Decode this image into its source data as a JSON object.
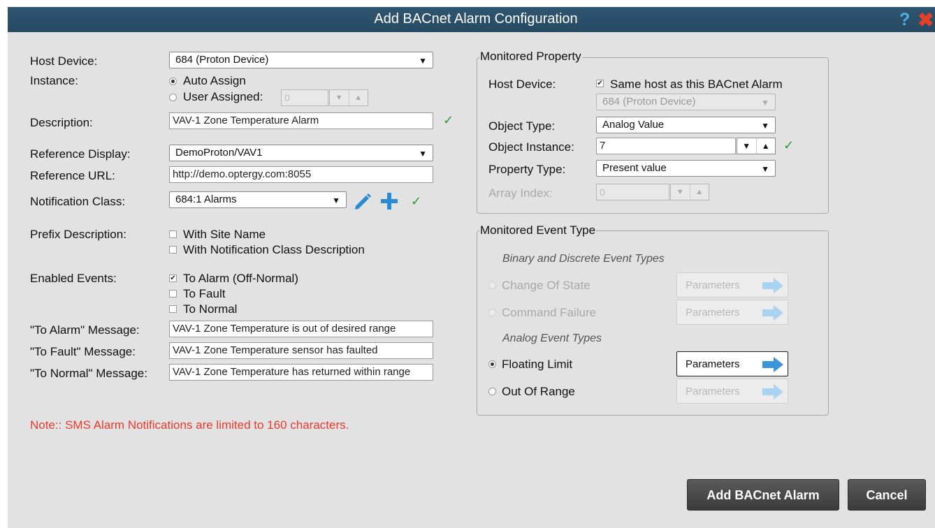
{
  "window": {
    "title": "Add BACnet Alarm Configuration",
    "help_icon": "help-icon",
    "close_icon": "close-icon"
  },
  "left": {
    "host_device": {
      "label": "Host Device:",
      "value": "684 (Proton Device)"
    },
    "instance": {
      "label": "Instance:",
      "auto_label": "Auto Assign",
      "user_label": "User Assigned:",
      "user_value": "0",
      "selected": "auto"
    },
    "description": {
      "label": "Description:",
      "value": "VAV-1 Zone Temperature Alarm",
      "valid": true
    },
    "reference_display": {
      "label": "Reference Display:",
      "value": "DemoProton/VAV1"
    },
    "reference_url": {
      "label": "Reference URL:",
      "value": "http://demo.optergy.com:8055"
    },
    "notification_class": {
      "label": "Notification Class:",
      "value": "684:1 Alarms",
      "valid": true
    },
    "prefix_description": {
      "label": "Prefix Description:",
      "opt1": "With Site Name",
      "opt2": "With Notification Class Description",
      "opt1_checked": false,
      "opt2_checked": false
    },
    "enabled_events": {
      "label": "Enabled Events:",
      "opt1": "To Alarm (Off-Normal)",
      "opt2": "To Fault",
      "opt3": "To Normal",
      "checks": [
        true,
        false,
        false
      ]
    },
    "to_alarm": {
      "label": "\"To Alarm\" Message:",
      "value": "VAV-1 Zone Temperature is out of desired range"
    },
    "to_fault": {
      "label": "\"To Fault\" Message:",
      "value": "VAV-1 Zone Temperature sensor has faulted"
    },
    "to_normal": {
      "label": "\"To Normal\" Message:",
      "value": "VAV-1 Zone Temperature has returned within range"
    },
    "note": "Note:: SMS Alarm Notifications are limited to 160 characters."
  },
  "monitored_property": {
    "legend": "Monitored Property",
    "host_device_label": "Host Device:",
    "same_host_label": "Same host as this BACnet Alarm",
    "same_host_checked": true,
    "host_value": "684 (Proton Device)",
    "object_type_label": "Object Type:",
    "object_type_value": "Analog Value",
    "object_instance_label": "Object Instance:",
    "object_instance_value": "7",
    "property_type_label": "Property Type:",
    "property_type_value": "Present value",
    "array_index_label": "Array Index:",
    "array_index_value": "0"
  },
  "monitored_event": {
    "legend": "Monitored Event Type",
    "binary_header": "Binary and Discrete Event Types",
    "analog_header": "Analog Event Types",
    "params_label": "Parameters",
    "types": [
      {
        "label": "Change Of State",
        "enabled": false,
        "selected": false
      },
      {
        "label": "Command Failure",
        "enabled": false,
        "selected": false
      },
      {
        "label": "Floating Limit",
        "enabled": true,
        "selected": true
      },
      {
        "label": "Out Of Range",
        "enabled": true,
        "selected": false
      }
    ]
  },
  "buttons": {
    "add": "Add BACnet Alarm",
    "cancel": "Cancel"
  },
  "colors": {
    "titlebar": "#2b5069",
    "accent_blue": "#2a8ad4",
    "valid_green": "#2e9a3a",
    "note_red": "#e83a2e"
  }
}
